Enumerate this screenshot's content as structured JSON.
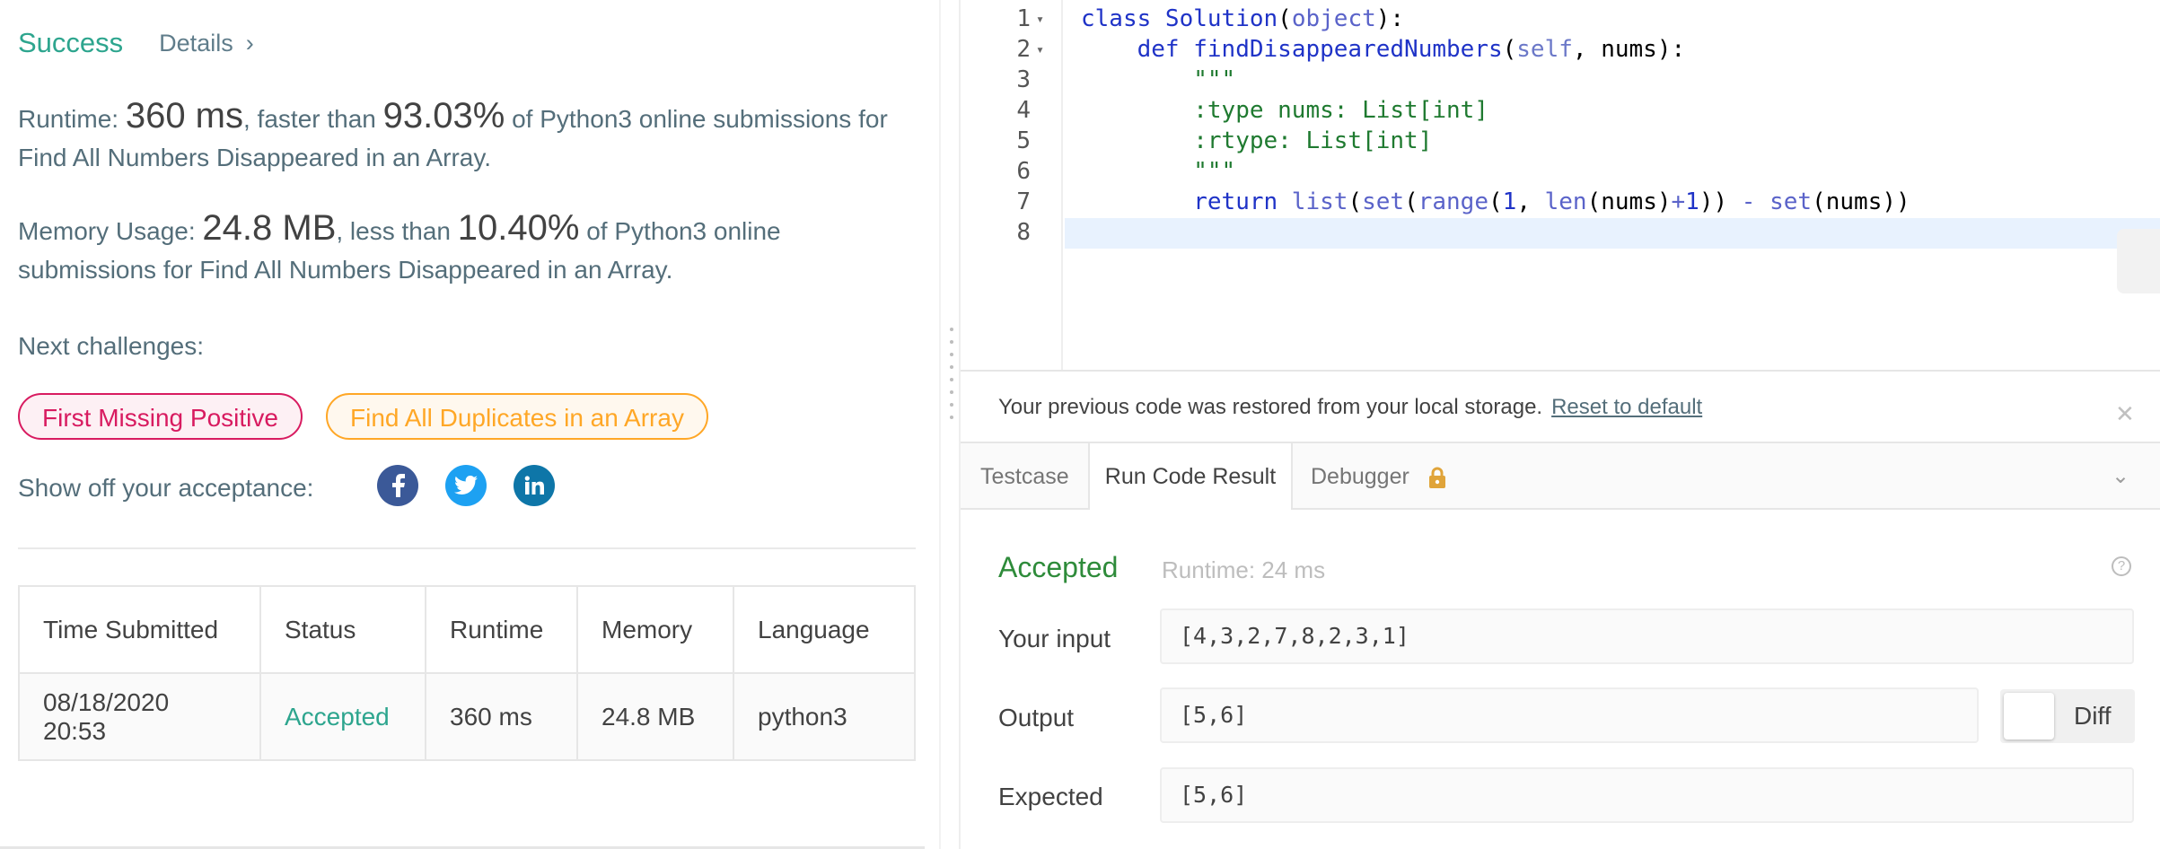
{
  "submission": {
    "status": "Success",
    "details_label": "Details",
    "details_chevron": "›",
    "runtime_label": "Runtime: ",
    "runtime_value": "360 ms",
    "runtime_mid": ", faster than ",
    "runtime_pct": "93.03%",
    "runtime_tail": " of Python3 online submissions for Find All Numbers Disappeared in an Array.",
    "memory_label": "Memory Usage: ",
    "memory_value": "24.8 MB",
    "memory_mid": ", less than ",
    "memory_pct": "10.40%",
    "memory_tail": " of Python3 online submissions for Find All Numbers Disappeared in an Array.",
    "next_label": "Next challenges:",
    "challenges": [
      "First Missing Positive",
      "Find All Duplicates in an Array"
    ],
    "share_label": "Show off your acceptance:",
    "social_icons": [
      "facebook-icon",
      "twitter-icon",
      "linkedin-icon"
    ]
  },
  "table": {
    "headers": [
      "Time Submitted",
      "Status",
      "Runtime",
      "Memory",
      "Language"
    ],
    "rows": [
      [
        "08/18/2020 20:53",
        "Accepted",
        "360 ms",
        "24.8 MB",
        "python3"
      ]
    ]
  },
  "editor": {
    "line_numbers": [
      "1",
      "2",
      "3",
      "4",
      "5",
      "6",
      "7",
      "8"
    ],
    "fold_marker": "▾",
    "code": {
      "l1_kw": "class",
      "l1_name": " Solution",
      "l1_open": "(",
      "l1_base": "object",
      "l1_close": "):",
      "l2_kw": "def",
      "l2_name": " findDisappearedNumbers",
      "l2_open": "(",
      "l2_self": "self",
      "l2_rest": ", nums):",
      "l3": "\"\"\"",
      "l4": ":type nums: List[int]",
      "l5": ":rtype: List[int]",
      "l6": "\"\"\"",
      "l7_kw": "return",
      "l7_list": " list",
      "l7_p1": "(",
      "l7_set1": "set",
      "l7_p2": "(",
      "l7_range": "range",
      "l7_p3": "(",
      "l7_one": "1",
      "l7_comma": ", ",
      "l7_len": "len",
      "l7_nums": "(nums)",
      "l7_plus": "+",
      "l7_one2": "1",
      "l7_cl": "))",
      "l7_minus": " - ",
      "l7_set2": "set",
      "l7_end": "(nums))"
    }
  },
  "notice": {
    "text": "Your previous code was restored from your local storage.",
    "link": "Reset to default",
    "close": "✕"
  },
  "tabs": {
    "items": [
      "Testcase",
      "Run Code Result",
      "Debugger"
    ],
    "active": "Run Code Result",
    "collapse_chevron": "⌄"
  },
  "result": {
    "status": "Accepted",
    "runtime": "Runtime: 24 ms",
    "help": "?",
    "input_label": "Your input",
    "input_value": "[4,3,2,7,8,2,3,1]",
    "output_label": "Output",
    "output_value": "[5,6]",
    "diff_label": "Diff",
    "expected_label": "Expected",
    "expected_value": "[5,6]"
  },
  "colors": {
    "success": "#2da58e",
    "accepted": "#2e8b3a",
    "chip_red": "#d81b60",
    "chip_orange": "#ffa726",
    "facebook": "#3b5998",
    "twitter": "#1da1f2",
    "linkedin": "#0e76a8"
  }
}
